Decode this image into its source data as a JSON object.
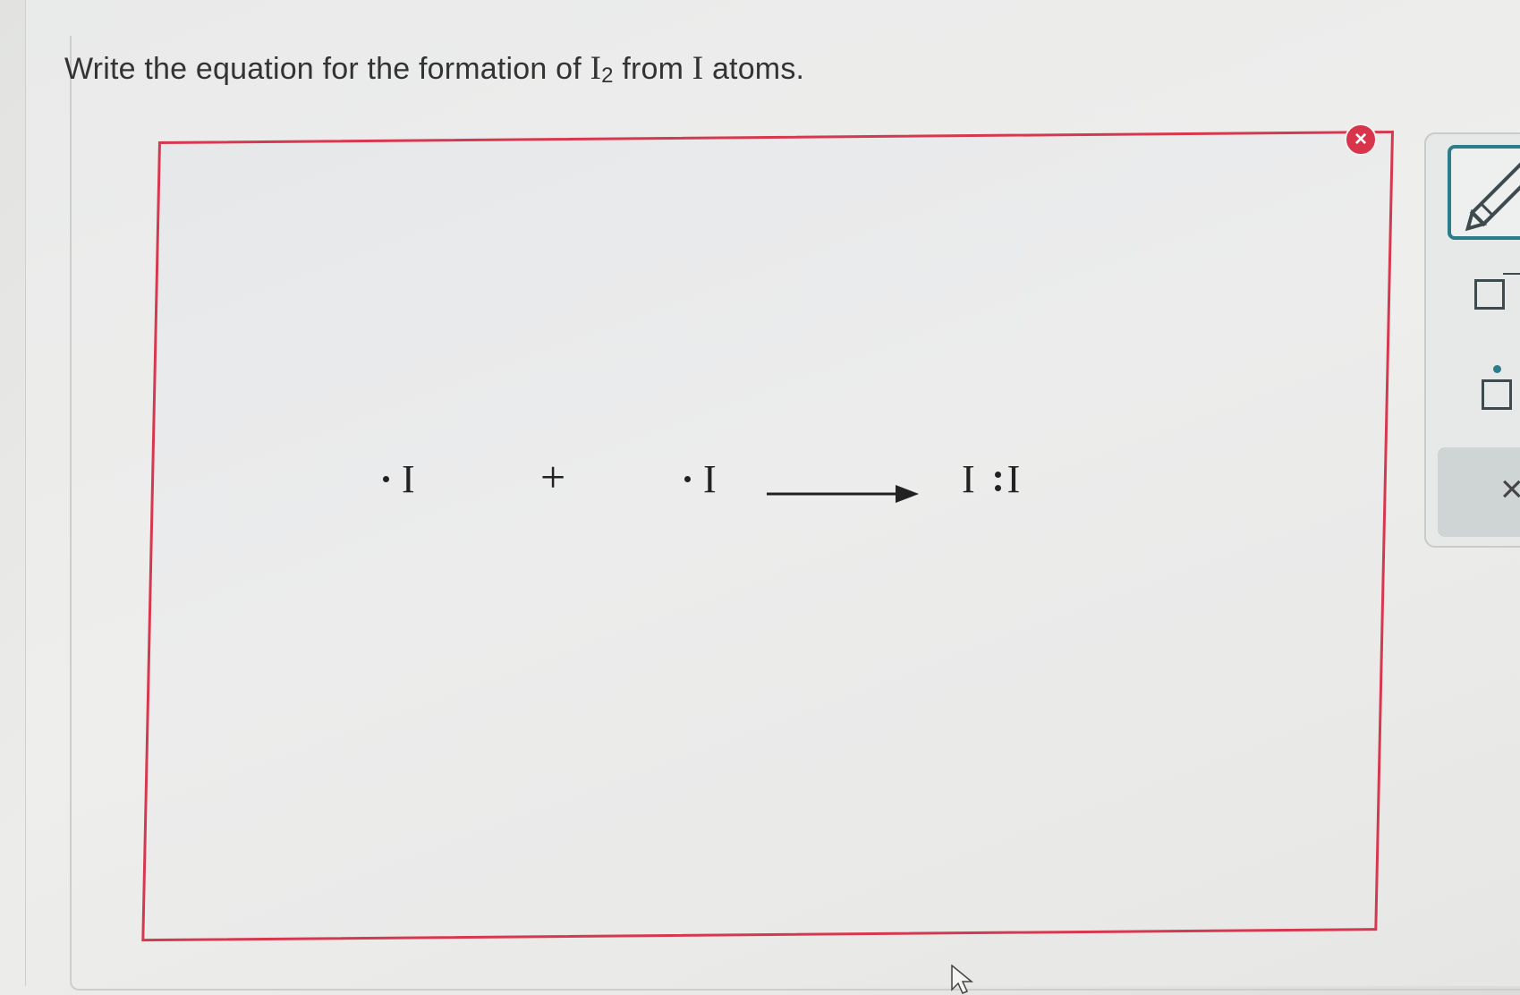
{
  "question": {
    "prefix": "Write the equation for the formation of ",
    "molecule": "I",
    "subscript": "2",
    "middle": " from ",
    "atom": "I",
    "suffix": " atoms."
  },
  "equation": {
    "reactant1": "I",
    "plus": "+",
    "reactant2": "I",
    "product_left": "I",
    "product_right": "I"
  },
  "canvas": {
    "close_label": "×"
  },
  "toolbar": {
    "tools": [
      "pencil-icon",
      "box-icon",
      "box-with-dot-icon",
      "clear-icon"
    ],
    "clear_label": "×"
  },
  "colors": {
    "canvas_border": "#d6394f",
    "close_badge": "#d8344b",
    "tool_accent": "#2b7d8c"
  }
}
